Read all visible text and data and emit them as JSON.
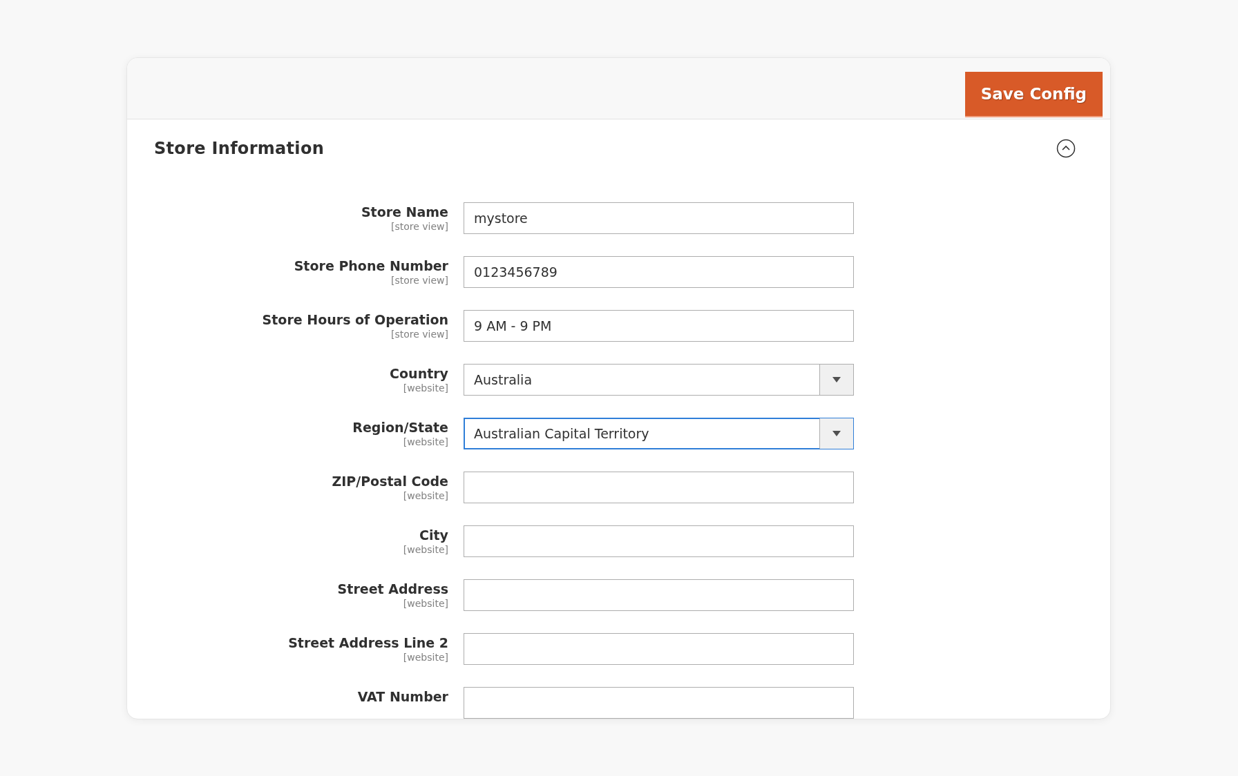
{
  "toolbar": {
    "save_button": "Save Config"
  },
  "section": {
    "title": "Store Information",
    "expanded": true
  },
  "fields": [
    {
      "label": "Store Name",
      "scope": "[store view]",
      "kind": "text",
      "value": "mystore",
      "focused": false
    },
    {
      "label": "Store Phone Number",
      "scope": "[store view]",
      "kind": "text",
      "value": "0123456789",
      "focused": false
    },
    {
      "label": "Store Hours of Operation",
      "scope": "[store view]",
      "kind": "text",
      "value": "9 AM - 9 PM",
      "focused": false
    },
    {
      "label": "Country",
      "scope": "[website]",
      "kind": "select",
      "value": "Australia",
      "focused": false
    },
    {
      "label": "Region/State",
      "scope": "[website]",
      "kind": "select",
      "value": "Australian Capital Territory",
      "focused": true
    },
    {
      "label": "ZIP/Postal Code",
      "scope": "[website]",
      "kind": "text",
      "focused": false
    },
    {
      "label": "City",
      "scope": "[website]",
      "kind": "text",
      "focused": false
    },
    {
      "label": "Street Address",
      "scope": "[website]",
      "kind": "text",
      "focused": false
    },
    {
      "label": "Street Address Line 2",
      "scope": "[website]",
      "kind": "text",
      "focused": false
    },
    {
      "label": "VAT Number",
      "kind": "text",
      "focused": false
    }
  ]
}
